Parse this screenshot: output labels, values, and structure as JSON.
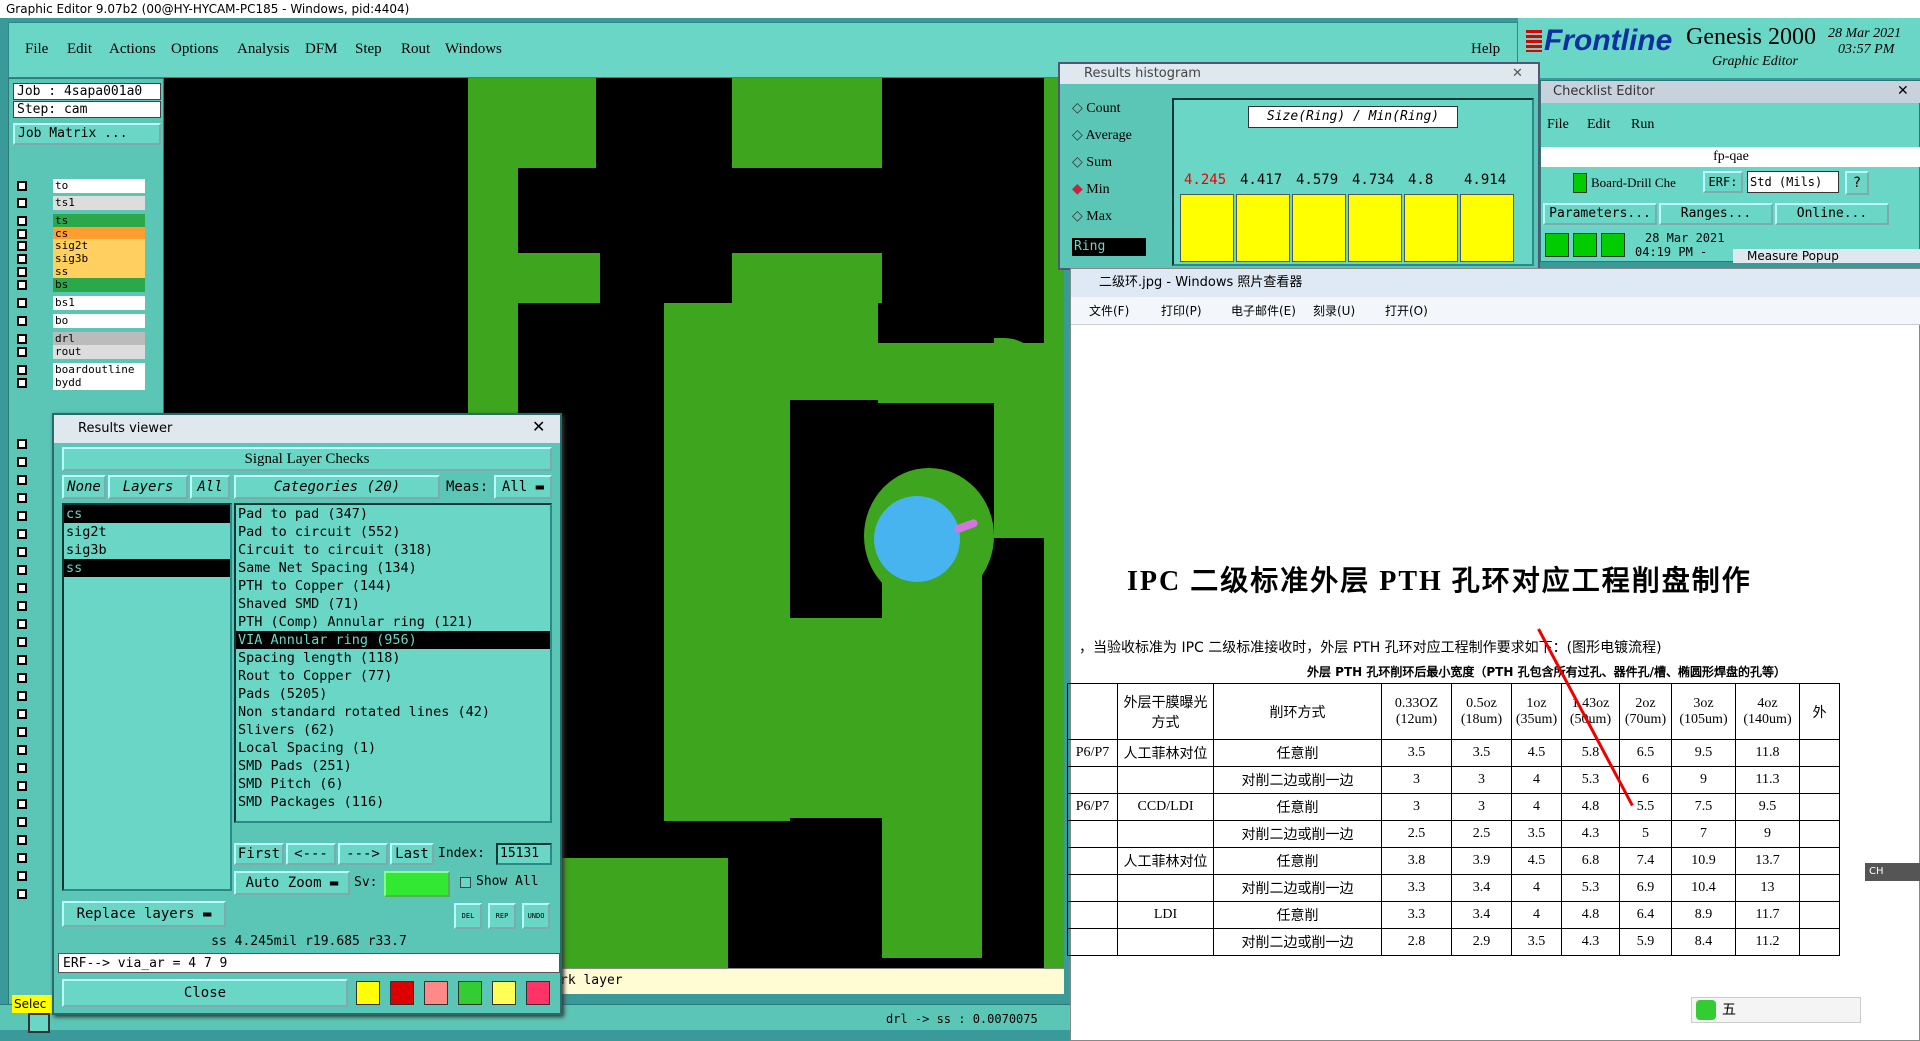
{
  "app": {
    "title": "Graphic Editor 9.07b2 (00@HY-HYCAM-PC185 - Windows, pid:4404)",
    "menu": [
      "File",
      "Edit",
      "Actions",
      "Options",
      "Analysis",
      "DFM",
      "Step",
      "Rout",
      "Windows"
    ],
    "help": "Help",
    "brand": "Frontline",
    "product": "Genesis 2000",
    "product_sub": "Graphic Editor",
    "date": "28 Mar 2021",
    "time": "03:57 PM"
  },
  "left": {
    "job": "Job : 4sapa001a0",
    "step": "Step: cam",
    "job_matrix": "Job Matrix ...",
    "layers": [
      "to",
      "ts1",
      "ts",
      "cs",
      "sig2t",
      "sig3b",
      "ss",
      "bs",
      "bs1",
      "bo",
      "drl",
      "rout",
      "boardoutline",
      "bydd"
    ],
    "select_label": "Selec"
  },
  "status": {
    "bottom_text": "rk layer",
    "measure": "drl -> ss : 0.0070075"
  },
  "results_viewer": {
    "title": "Results viewer",
    "header": "Signal Layer Checks",
    "none": "None",
    "layers": "Layers",
    "all": "All",
    "categories": "Categories (20)",
    "meas": "Meas:",
    "meas_val": "All",
    "layer_list": [
      "cs",
      "sig2t",
      "sig3b",
      "ss"
    ],
    "selected_layers": [
      "cs",
      "ss"
    ],
    "category_list": [
      "Pad to pad (347)",
      "Pad to circuit (552)",
      "Circuit to circuit (318)",
      "Same Net Spacing (134)",
      "PTH to Copper (144)",
      "Shaved SMD (71)",
      "PTH (Comp) Annular ring (121)",
      "VIA Annular ring (956)",
      "Spacing length (118)",
      "Rout to Copper (77)",
      "Pads (5205)",
      "Non standard rotated lines (42)",
      "Slivers (62)",
      "Local Spacing (1)",
      "SMD Pads (251)",
      "SMD Pitch (6)",
      "SMD Packages (116)"
    ],
    "selected_category": "VIA Annular ring (956)",
    "first": "First",
    "prev": "<---",
    "next": "--->",
    "last": "Last",
    "index_label": "Index:",
    "index_val": "15131",
    "auto_zoom": "Auto Zoom",
    "sv": "Sv:",
    "show_all": "Show All",
    "replace_layers": "Replace layers",
    "status": "ss 4.245mil  r19.685  r33.7",
    "erf": "ERF--> via_ar = 4 7 9",
    "close": "Close",
    "small_btns": [
      "DEL",
      "REP",
      "UNDO"
    ]
  },
  "histogram": {
    "title": "Results histogram",
    "options": [
      "Count",
      "Average",
      "Sum",
      "Min",
      "Max"
    ],
    "selected": "Min",
    "ring": "Ring",
    "chart_title": "Size(Ring) / Min(Ring)",
    "values": [
      "4.245",
      "4.417",
      "4.579",
      "4.734",
      "4.8",
      "4.914"
    ]
  },
  "checklist": {
    "title": "Checklist Editor",
    "menu": [
      "File",
      "Edit",
      "Run"
    ],
    "name": "fp-qae",
    "check": "Board-Drill Che",
    "erf": "ERF:",
    "std": "Std (Mils)",
    "q": "?",
    "parameters": "Parameters...",
    "ranges": "Ranges...",
    "online": "Online...",
    "date": "28 Mar 2021",
    "time": "04:19 PM -",
    "measure_popup": "Measure Popup"
  },
  "photo": {
    "title": "二级环.jpg - Windows 照片查看器",
    "menu": [
      "文件(F)",
      "打印(P)",
      "电子邮件(E)",
      "刻录(U)",
      "打开(O)"
    ],
    "heading": "IPC 二级标准外层 PTH 孔环对应工程削盘制作",
    "intro": "，当验收标准为 IPC 二级标准接收时，外层 PTH 孔环对应工程制作要求如下：(图形电镀流程)",
    "subtitle": "外层 PTH 孔环削环后最小宽度（PTH 孔包含所有过孔、器件孔/槽、椭圆形焊盘的孔等）",
    "col_headers": [
      "外层干膜曝光方式",
      "削环方式",
      "0.33OZ (12um)",
      "0.5oz (18um)",
      "1oz (35um)",
      "1.43oz (50um)",
      "2oz (70um)",
      "3oz (105um)",
      "4oz (140um)",
      "外"
    ],
    "rows": [
      {
        "left": "P6/P7",
        "method": "人工菲林对位",
        "cut": "任意削",
        "vals": [
          "3.5",
          "3.5",
          "4.5",
          "5.8",
          "6.5",
          "9.5",
          "11.8"
        ]
      },
      {
        "left": "",
        "method": "",
        "cut": "对削二边或削一边",
        "vals": [
          "3",
          "3",
          "4",
          "5.3",
          "6",
          "9",
          "11.3"
        ]
      },
      {
        "left": "P6/P7",
        "method": "CCD/LDI",
        "cut": "任意削",
        "vals": [
          "3",
          "3",
          "4",
          "4.8",
          "5.5",
          "7.5",
          "9.5"
        ]
      },
      {
        "left": "",
        "method": "",
        "cut": "对削二边或削一边",
        "vals": [
          "2.5",
          "2.5",
          "3.5",
          "4.3",
          "5",
          "7",
          "9"
        ]
      },
      {
        "left": "",
        "method": "人工菲林对位",
        "cut": "任意削",
        "vals": [
          "3.8",
          "3.9",
          "4.5",
          "6.8",
          "7.4",
          "10.9",
          "13.7"
        ]
      },
      {
        "left": "",
        "method": "",
        "cut": "对削二边或削一边",
        "vals": [
          "3.3",
          "3.4",
          "4",
          "5.3",
          "6.9",
          "10.4",
          "13"
        ]
      },
      {
        "left": "",
        "method": "LDI",
        "cut": "任意削",
        "vals": [
          "3.3",
          "3.4",
          "4",
          "4.8",
          "6.4",
          "8.9",
          "11.7"
        ]
      },
      {
        "left": "",
        "method": "",
        "cut": "对削二边或削一边",
        "vals": [
          "2.8",
          "2.9",
          "3.5",
          "4.3",
          "5.9",
          "8.4",
          "11.2"
        ]
      }
    ],
    "ime": "五",
    "ch": "CH"
  },
  "colors": {
    "teal": "#5cc6b6",
    "copper": "#3ea51e",
    "pad": "#47b4f0",
    "yellow": "#ffff00"
  }
}
